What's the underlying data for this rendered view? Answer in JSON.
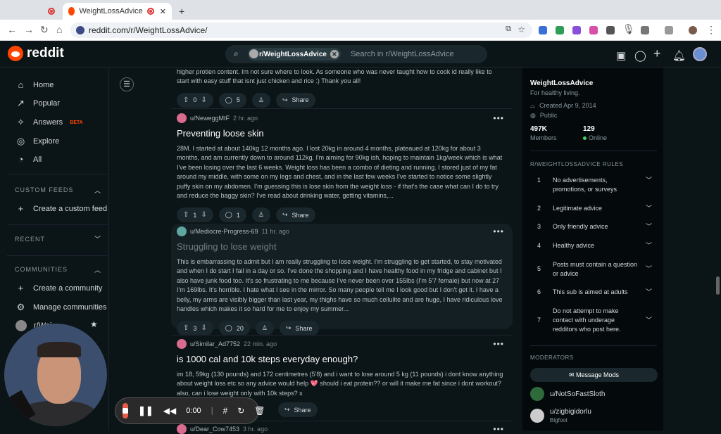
{
  "browser": {
    "tab_label": "WeightLossAdvice",
    "url": "reddit.com/r/WeightLossAdvice/",
    "new_tab": "+"
  },
  "header": {
    "logo_text": "reddit",
    "search_chip": "r/WeightLossAdvice",
    "search_placeholder": "Search in r/WeightLossAdvice"
  },
  "sidebar": {
    "items": [
      {
        "label": "Home",
        "icon": "home-icon"
      },
      {
        "label": "Popular",
        "icon": "popular-icon"
      },
      {
        "label": "Answers",
        "icon": "answers-icon",
        "badge": "BETA"
      },
      {
        "label": "Explore",
        "icon": "explore-icon"
      },
      {
        "label": "All",
        "icon": "all-icon"
      }
    ],
    "custom_feeds_heading": "CUSTOM FEEDS",
    "create_custom_feed": "Create a custom feed",
    "recent_heading": "RECENT",
    "communities_heading": "COMMUNITIES",
    "create_community": "Create a community",
    "manage_communities": "Manage communities",
    "community_partial": "r/Wei"
  },
  "posts": [
    {
      "body": "higher protien content. Im not sure where to look. As someone who was never taught how to cook id really like to start with easy stuff that isnt just chicken and rice :) Thank you all!",
      "votes": "0",
      "comments": "5",
      "share": "Share"
    },
    {
      "user": "u/NeweggMtF",
      "time": "2 hr. ago",
      "title": "Preventing loose skin",
      "body": "28M. I started at about 140kg 12 months ago. I lost 20kg in around 4 months, plateaued at 120kg for about 3 months, and am currently down to around 112kg. I'm aiming for 90kg ish, hoping to maintain 1kg/week which is what I've been losing over the last 6 weeks. Weight loss has been a combo of dieting and running. I stored just of my fat around my middle, with some on my legs and chest, and in the last few weeks I've started to notice some slightly puffy skin on my abdomen. I'm guessing this is lose skin from the weight loss - if that's the case what can I do to try and reduce the baggy skin? I've read about drinking water, getting vitamins,...",
      "votes": "1",
      "comments": "1",
      "share": "Share"
    },
    {
      "user": "u/Mediocre-Progress-69",
      "time": "11 hr. ago",
      "title": "Struggling to lose weight",
      "body": "This is embarrassing to admit but I am really struggling to lose weight. I'm struggling to get started, to stay motivated and when I do start I fail in a day or so. I've done the shopping and I have healthy food in my fridge and cabinet but I also have junk food too. It's so frustrating to me because I've never been over 155lbs (I'm 5'7 female) but now at 27 I'm 169lbs. It's horrible. I hate what I see in the mirror. So many people tell me I look good but I don't get it. I have a belly, my arms are visibly bigger than last year, my thighs have so much cellulite and are huge, I have ridiculous love handles which makes it so hard for me to enjoy my summer...",
      "votes": "3",
      "comments": "20",
      "share": "Share"
    },
    {
      "user": "u/Similar_Ad7752",
      "time": "22 min. ago",
      "title": "is 1000 cal and 10k steps everyday enough?",
      "body": "im 18, 59kg (130 pounds) and 172 centimetres (5'8) and i want to lose around 5 kg (11 pounds) i dont know anything about weight loss etc so any advice would help 💖 should i eat protein?? or will it make me fat since i dont workout? also, can i lose weight only with 10k steps? x",
      "share": "Share"
    },
    {
      "user": "u/Dear_Cow7453",
      "time": "3 hr. ago"
    }
  ],
  "about": {
    "name": "WeightLossAdvice",
    "tagline": "For healthy living.",
    "created": "Created Apr 9, 2014",
    "visibility": "Public",
    "members_count": "497K",
    "members_label": "Members",
    "online_count": "129",
    "online_label": "Online",
    "online_color": "#46d160"
  },
  "rules": {
    "heading": "R/WEIGHTLOSSADVICE RULES",
    "items": [
      {
        "n": "1",
        "text": "No advertisements, promotions, or surveys"
      },
      {
        "n": "2",
        "text": "Legitimate advice"
      },
      {
        "n": "3",
        "text": "Only friendly advice"
      },
      {
        "n": "4",
        "text": "Healthy advice"
      },
      {
        "n": "5",
        "text": "Posts must contain a question or advice"
      },
      {
        "n": "6",
        "text": "This sub is aimed at adults"
      },
      {
        "n": "7",
        "text": "Do not attempt to make contact with underage redditors who post here."
      }
    ]
  },
  "moderators": {
    "heading": "MODERATORS",
    "message_button": "Message Mods",
    "mods": [
      {
        "name": "u/NotSoFastSloth",
        "flair": ""
      },
      {
        "name": "u/zigbigidorlu",
        "flair": "Bigfoot"
      }
    ]
  },
  "recorder": {
    "time": "0:00"
  },
  "colors": {
    "brand": "#ff4500",
    "background": "#0b1416",
    "panel": "#04090b"
  }
}
